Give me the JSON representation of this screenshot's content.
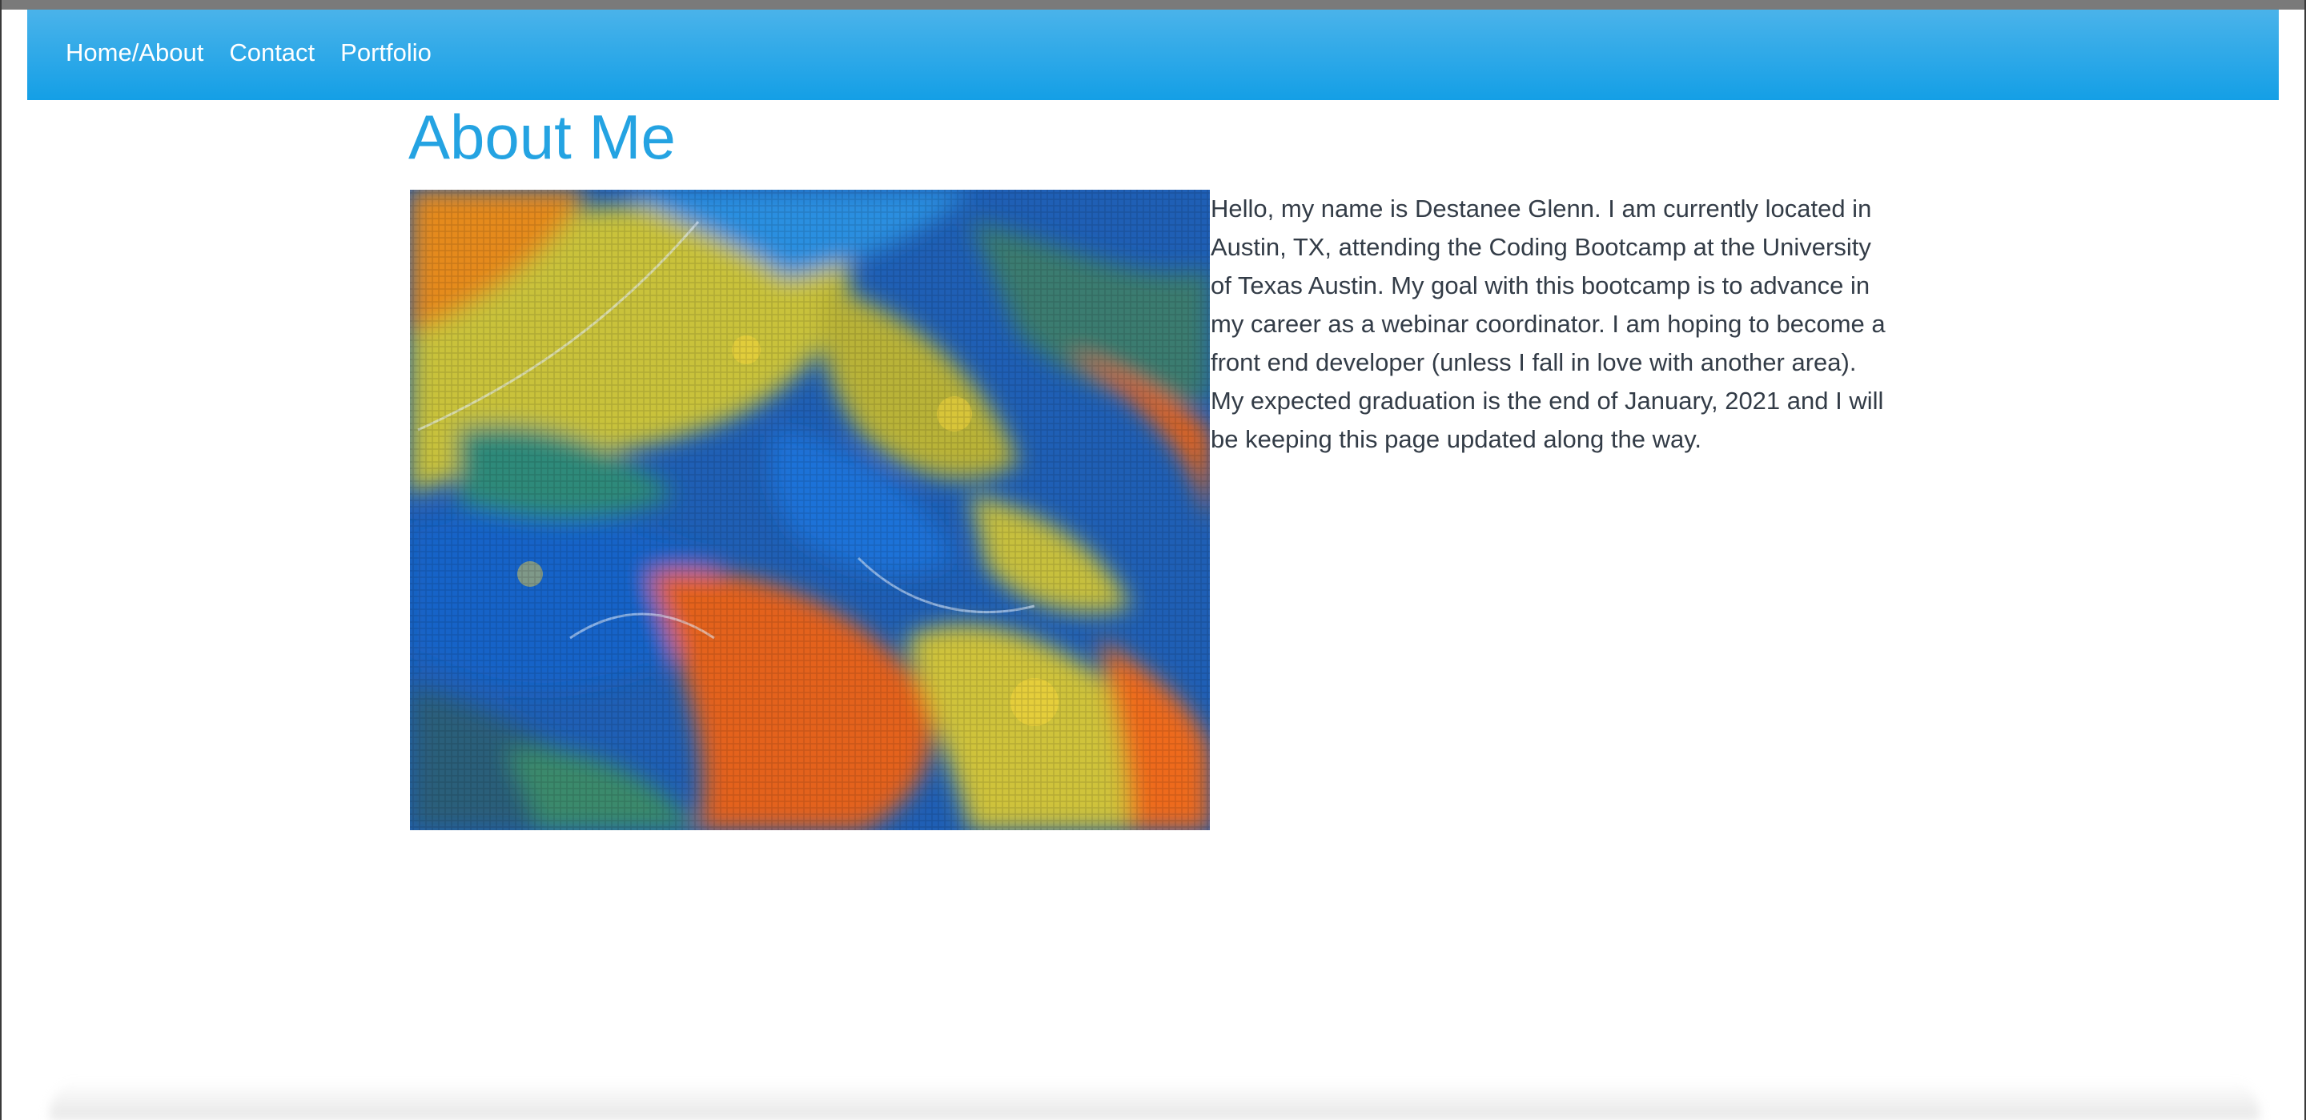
{
  "nav": {
    "links": [
      {
        "label": "Home/About"
      },
      {
        "label": "Contact"
      },
      {
        "label": "Portfolio"
      }
    ],
    "colors": {
      "bar_top": "#4ab3ea",
      "bar_bottom": "#149fe6",
      "text": "#ffffff"
    }
  },
  "main": {
    "title": "About Me",
    "title_color": "#24a3e2",
    "bio": "Hello, my name is Destanee Glenn. I am currently located in Austin, TX, attending the Coding Bootcamp at the University of Texas Austin. My goal with this bootcamp is to advance in my career as a webinar coordinator. I am hoping to become a front end developer (unless I fall in love with another area). My expected graduation is the end of January, 2021 and I will be keeping this page updated along the way.",
    "image": {
      "kind": "abstract-acrylic-pour-painting",
      "colors": [
        "#1a6fd6",
        "#d6c72a",
        "#e8651c",
        "#2f8f7a"
      ]
    }
  }
}
